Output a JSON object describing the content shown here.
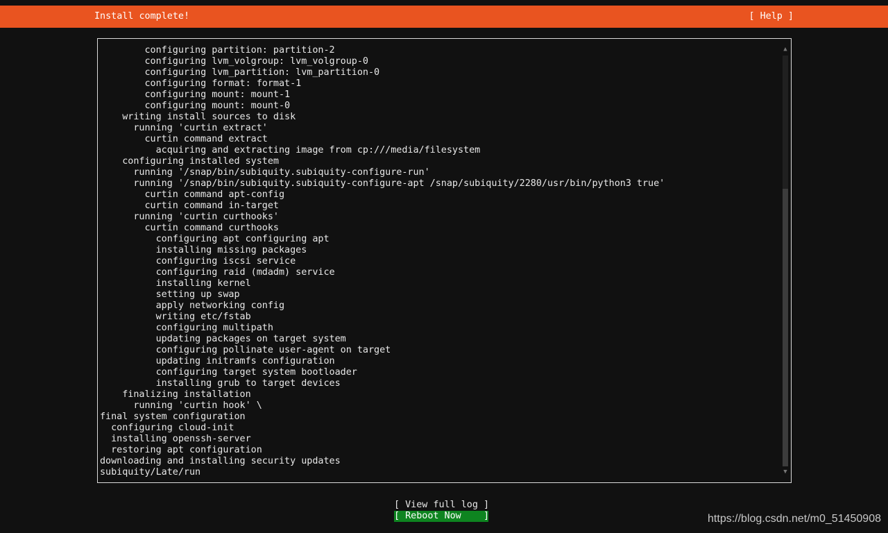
{
  "header": {
    "title": "Install complete!",
    "help_label": "[ Help ]",
    "color": "#e95420"
  },
  "log": {
    "lines": [
      "        configuring partition: partition-2",
      "        configuring lvm_volgroup: lvm_volgroup-0",
      "        configuring lvm_partition: lvm_partition-0",
      "        configuring format: format-1",
      "        configuring mount: mount-1",
      "        configuring mount: mount-0",
      "    writing install sources to disk",
      "      running 'curtin extract'",
      "        curtin command extract",
      "          acquiring and extracting image from cp:///media/filesystem",
      "    configuring installed system",
      "      running '/snap/bin/subiquity.subiquity-configure-run'",
      "      running '/snap/bin/subiquity.subiquity-configure-apt /snap/subiquity/2280/usr/bin/python3 true'",
      "        curtin command apt-config",
      "        curtin command in-target",
      "      running 'curtin curthooks'",
      "        curtin command curthooks",
      "          configuring apt configuring apt",
      "          installing missing packages",
      "          configuring iscsi service",
      "          configuring raid (mdadm) service",
      "          installing kernel",
      "          setting up swap",
      "          apply networking config",
      "          writing etc/fstab",
      "          configuring multipath",
      "          updating packages on target system",
      "          configuring pollinate user-agent on target",
      "          updating initramfs configuration",
      "          configuring target system bootloader",
      "          installing grub to target devices",
      "    finalizing installation",
      "      running 'curtin hook' \\",
      "final system configuration",
      "  configuring cloud-init",
      "  installing openssh-server",
      "  restoring apt configuration",
      "downloading and installing security updates",
      "subiquity/Late/run"
    ],
    "scroll_up_icon": "▲",
    "scroll_down_icon": "▼"
  },
  "actions": {
    "view_log_label": "[ View full log ]",
    "reboot_label": "[ Reboot Now    ]",
    "reboot_color": "#0e8420"
  },
  "watermark": "https://blog.csdn.net/m0_51450908"
}
